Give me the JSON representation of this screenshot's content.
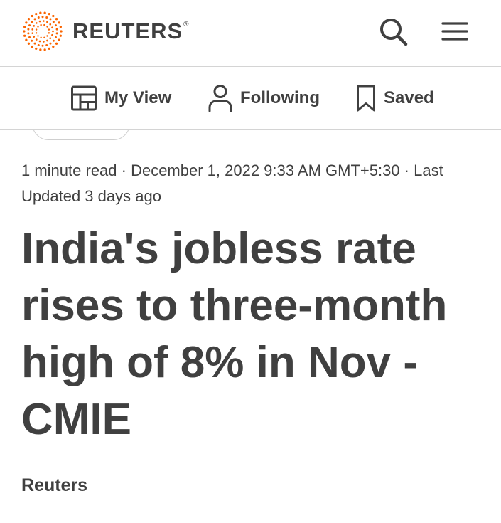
{
  "header": {
    "brand": "REUTERS",
    "trademark": "®",
    "logo_icon": "reuters-dotted-sphere-logo",
    "search_icon": "search-icon",
    "menu_icon": "hamburger-menu-icon",
    "brand_color": "#fa6400",
    "text_color": "#404040"
  },
  "subnav": {
    "items": [
      {
        "label": "My View",
        "icon": "layout-grid-icon"
      },
      {
        "label": "Following",
        "icon": "person-icon"
      },
      {
        "label": "Saved",
        "icon": "bookmark-icon"
      }
    ]
  },
  "article": {
    "meta_line": "1 minute read · December 1, 2022 9:33 AM GMT+5:30 · Last Updated 3 days ago",
    "headline": "India's jobless rate rises to three-month high of 8% in Nov - CMIE",
    "byline": "Reuters"
  }
}
